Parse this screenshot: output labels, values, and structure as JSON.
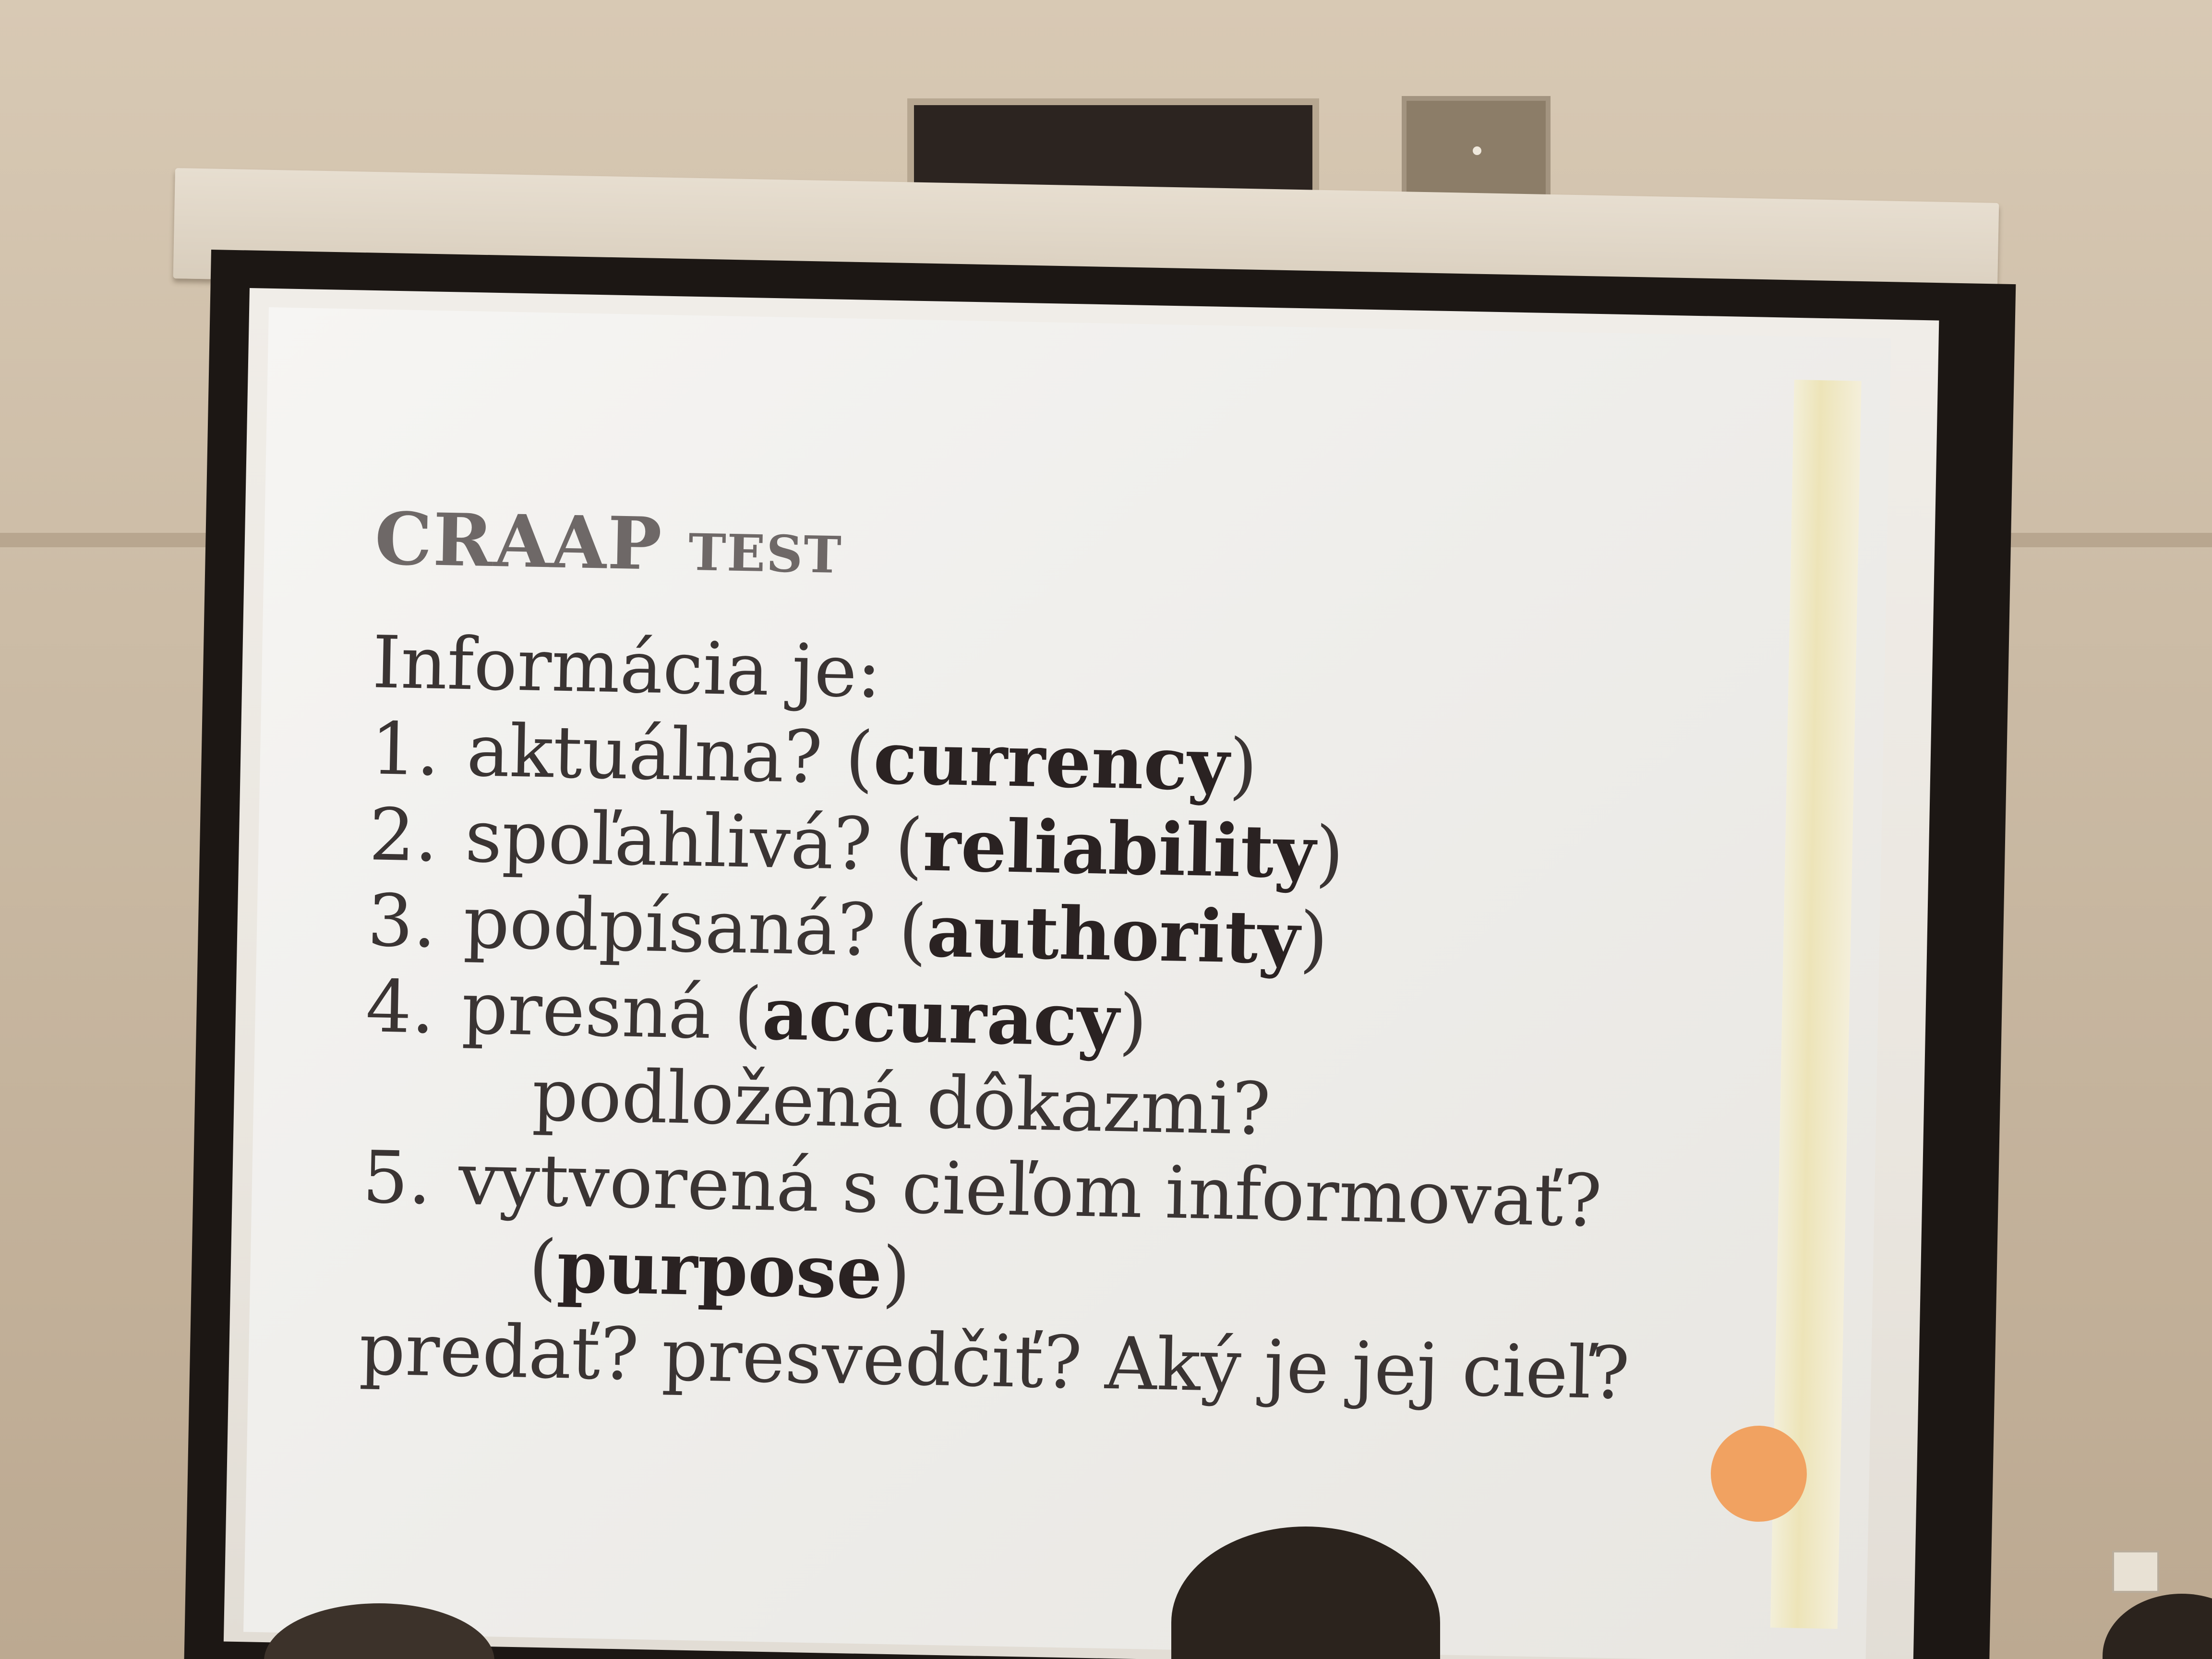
{
  "slide": {
    "title_main": "CRAAP",
    "title_small": "TEST",
    "intro": "Informácia je:",
    "items": [
      {
        "num": "1.",
        "text": "aktuálna? (",
        "bold": "currency",
        "close": ")"
      },
      {
        "num": "2.",
        "text": "spoľahlivá? (",
        "bold": "reliability",
        "close": ")"
      },
      {
        "num": "3.",
        "text": "podpísaná? (",
        "bold": "authority",
        "close": ")"
      },
      {
        "num": "4.",
        "text": "presná (",
        "bold": "accuracy",
        "close": ")"
      }
    ],
    "item4_sub": "podložená dôkazmi?",
    "item5": {
      "num": "5.",
      "text": "vytvorená s cieľom informovať?"
    },
    "item5_sub_open": "(",
    "item5_sub_bold": "purpose",
    "item5_sub_close": ")",
    "closing": "predať? presvedčiť? Aký je jej cieľ?"
  },
  "colors": {
    "accent_dot": "#f1a261",
    "text": "#3a3433",
    "title": "#6e6867"
  }
}
